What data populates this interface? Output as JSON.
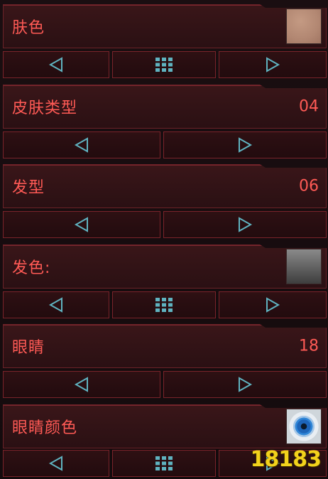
{
  "settings": [
    {
      "label": "肤色",
      "value": "",
      "swatch": "skin",
      "controls": "three"
    },
    {
      "label": "皮肤类型",
      "value": "04",
      "swatch": "",
      "controls": "two"
    },
    {
      "label": "发型",
      "value": "06",
      "swatch": "",
      "controls": "two"
    },
    {
      "label": "发色:",
      "value": "",
      "swatch": "hair",
      "controls": "three"
    },
    {
      "label": "眼睛",
      "value": "18",
      "swatch": "",
      "controls": "two"
    },
    {
      "label": "眼睛颜色",
      "value": "",
      "swatch": "eye",
      "controls": "three"
    }
  ],
  "icons": {
    "prev": "triangle-left-icon",
    "next": "triangle-right-icon",
    "palette": "grid-icon"
  },
  "colors": {
    "accent_text": "#ff5a55",
    "border": "#7a232a",
    "icon": "#5fb3c0",
    "background": "#140b0d"
  },
  "watermark": "18183"
}
